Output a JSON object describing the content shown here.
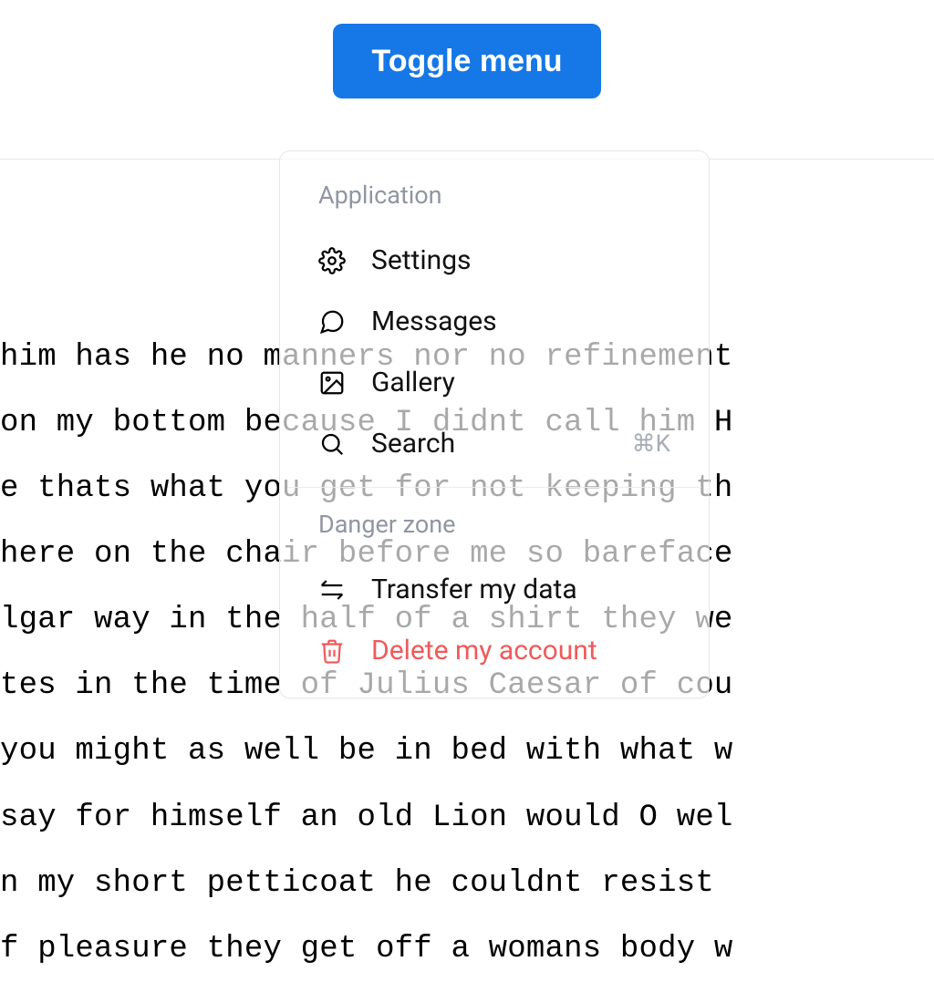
{
  "toggle_button": {
    "label": "Toggle menu"
  },
  "background_text": "him has he no manners nor no refinement\non my bottom because I didnt call him H\ne thats what you get for not keeping th\nhere on the chair before me so bareface\nlgar way in the half of a shirt they we\ntes in the time of Julius Caesar of cou\nyou might as well be in bed with what w\nsay for himself an old Lion would O wel\nn my short petticoat he couldnt resist \nf pleasure they get off a womans body w",
  "menu": {
    "groups": [
      {
        "label": "Application",
        "items": [
          {
            "key": "settings",
            "label": "Settings",
            "icon": "gear",
            "shortcut": ""
          },
          {
            "key": "messages",
            "label": "Messages",
            "icon": "chat",
            "shortcut": ""
          },
          {
            "key": "gallery",
            "label": "Gallery",
            "icon": "image",
            "shortcut": ""
          },
          {
            "key": "search",
            "label": "Search",
            "icon": "search",
            "shortcut": "⌘K"
          }
        ]
      },
      {
        "label": "Danger zone",
        "items": [
          {
            "key": "transfer",
            "label": "Transfer my data",
            "icon": "arrows",
            "shortcut": ""
          },
          {
            "key": "delete",
            "label": "Delete my account",
            "icon": "trash",
            "shortcut": "",
            "danger": true
          }
        ]
      }
    ]
  }
}
